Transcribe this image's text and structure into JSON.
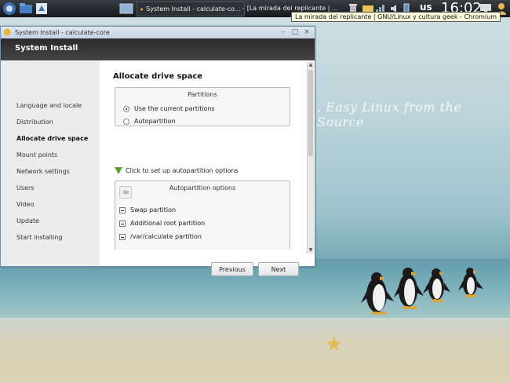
{
  "taskbar": {
    "tasks": [
      {
        "label": "System Install - calculate-co…"
      },
      {
        "label": "[La mirada del replicante | …"
      }
    ],
    "tooltip": "La mirada del replicante | GNU/Linux y cultura geek - Chromium",
    "keyboard_layout": "us",
    "clock": "16:02"
  },
  "wallpaper": {
    "tagline": ". Easy Linux from the Source"
  },
  "window": {
    "title": "System Install - calculate-core",
    "header": "System Install",
    "sidebar": [
      {
        "label": "Language and locale",
        "active": false
      },
      {
        "label": "Distribution",
        "active": false
      },
      {
        "label": "Allocate drive space",
        "active": true
      },
      {
        "label": "Mount points",
        "active": false
      },
      {
        "label": "Network settings",
        "active": false
      },
      {
        "label": "Users",
        "active": false
      },
      {
        "label": "Video",
        "active": false
      },
      {
        "label": "Update",
        "active": false
      },
      {
        "label": "Start installing",
        "active": false
      }
    ],
    "content": {
      "title": "Allocate drive space",
      "partitions_group": {
        "title": "Partitions",
        "options": [
          {
            "label": "Use the current partitions",
            "selected": true
          },
          {
            "label": "Autopartition",
            "selected": false
          }
        ]
      },
      "expander_label": "Click to set up autopartition options",
      "autopartition_group": {
        "title": "Autopartition options",
        "options": [
          {
            "label": "Swap partition"
          },
          {
            "label": "Additional root partition"
          },
          {
            "label": "/var/calculate partition"
          }
        ]
      }
    },
    "buttons": {
      "previous": "Previous",
      "next": "Next"
    }
  },
  "colors": {
    "header_bg": "#333333",
    "window_border": "#6f8fb4",
    "expander_arrow": "#5aa02c"
  }
}
